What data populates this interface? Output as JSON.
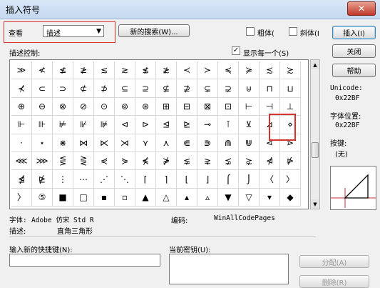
{
  "window": {
    "title": "插入符号",
    "close_glyph": "✕"
  },
  "view": {
    "label": "查看",
    "select_value": "描述",
    "arrow": "▼"
  },
  "new_search_button": "新的搜索(W)...",
  "bold": {
    "label": "粗体(",
    "checked": false
  },
  "italic": {
    "label": "斜体(I",
    "checked": false
  },
  "insert_button": "插入(I)",
  "close_button": "关闭",
  "help_button": "帮助",
  "desc_control_label": "描述控制:",
  "show_each": {
    "label": "显示每一个(S)",
    "checked": true,
    "check_glyph": "✓"
  },
  "grid": {
    "rows": [
      [
        "≫",
        "≮",
        "≰",
        "≱",
        "≲",
        "≳",
        "≴",
        "≵",
        "≺",
        "≻",
        "≼",
        "≽",
        "≾",
        "≿"
      ],
      [
        "⊀",
        "⊂",
        "⊃",
        "⊄",
        "⊅",
        "⊆",
        "⊇",
        "⊈",
        "⊉",
        "⊊",
        "⊋",
        "⊍",
        "⊓",
        "⊔"
      ],
      [
        "⊕",
        "⊖",
        "⊗",
        "⊘",
        "⊙",
        "⊚",
        "⊛",
        "⊞",
        "⊟",
        "⊠",
        "⊡",
        "⊢",
        "⊣",
        "⊥"
      ],
      [
        "⊩",
        "⊪",
        "⊭",
        "⊮",
        "⊯",
        "⊲",
        "⊳",
        "⊴",
        "⊵",
        "⊸",
        "⊺",
        "⊻",
        "⊿",
        "⋄"
      ],
      [
        "⋅",
        "⋆",
        "⋇",
        "⋈",
        "⋉",
        "⋊",
        "⋎",
        "⋏",
        "⋐",
        "⋑",
        "⋒",
        "⋓",
        "⋖",
        "⋗"
      ],
      [
        "⋘",
        "⋙",
        "⋚",
        "⋛",
        "⋞",
        "⋟",
        "⋠",
        "⋡",
        "⋦",
        "⋧",
        "⋨",
        "⋩",
        "⋪",
        "⋫"
      ],
      [
        "⋬",
        "⋭",
        "⋮",
        "⋯",
        "⋰",
        "⋱",
        "⌈",
        "⌉",
        "⌊",
        "⌋",
        "⌠",
        "⌡",
        "〈",
        "〉"
      ],
      [
        "〉",
        "⑤",
        "■",
        "□",
        "▪",
        "▫",
        "▲",
        "△",
        "▴",
        "▵",
        "▼",
        "▽",
        "▾",
        "◆"
      ]
    ],
    "selected_row": 3,
    "selected_col": 12
  },
  "unicode_label": "Unicode:",
  "unicode_value": "0x22BF",
  "font_pos_label": "字体位置:",
  "font_pos_value": "0x22BF",
  "key_label": "按键:",
  "key_value": "(无)",
  "font_info_label": "字体:",
  "font_info_value": "Adobe 仿宋 Std R",
  "encoding_label": "编码:",
  "encoding_value": "WinAllCodePages",
  "description_label": "描述:",
  "description_value": "直角三角形",
  "new_shortcut_label": "输入新的快捷键(N):",
  "current_key_label": "当前密钥(U):",
  "assign_button": "分配(A)",
  "delete_button": "删除(R)"
}
